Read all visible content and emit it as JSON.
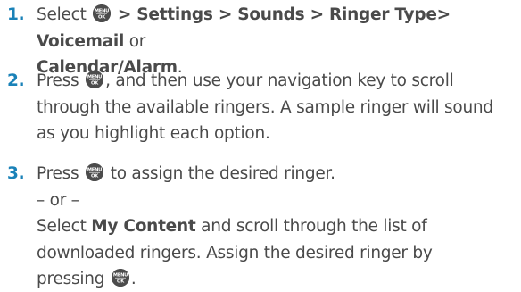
{
  "steps": [
    {
      "number": "1.",
      "select": "Select",
      "path": "> Settings > Sounds > Ringer Type> Voicemail",
      "or": "or",
      "target": "Calendar/Alarm",
      "end": "."
    },
    {
      "number": "2.",
      "press": "Press",
      "line1_rest": ", and then use your navigation key to scroll",
      "line2": "through the available ringers. A sample ringer will sound",
      "line3": "as you highlight each option."
    },
    {
      "number": "3.",
      "press": "Press",
      "line1_rest": "to assign the desired ringer.",
      "alt": "– or –",
      "select": "Select",
      "my_content": "My Content",
      "line_after_my_content": "and scroll through the list of",
      "line_next": "downloaded ringers. Assign the desired ringer by",
      "pressing": "pressing",
      "end": "."
    }
  ],
  "icons": {
    "menu_ok_key": "menu-ok-key-icon",
    "menu_text": "MENU",
    "ok_text": "OK"
  },
  "colors": {
    "step_number": "#1a82b8",
    "text": "#4a4a4a",
    "key_fill": "#4c4c4c"
  }
}
